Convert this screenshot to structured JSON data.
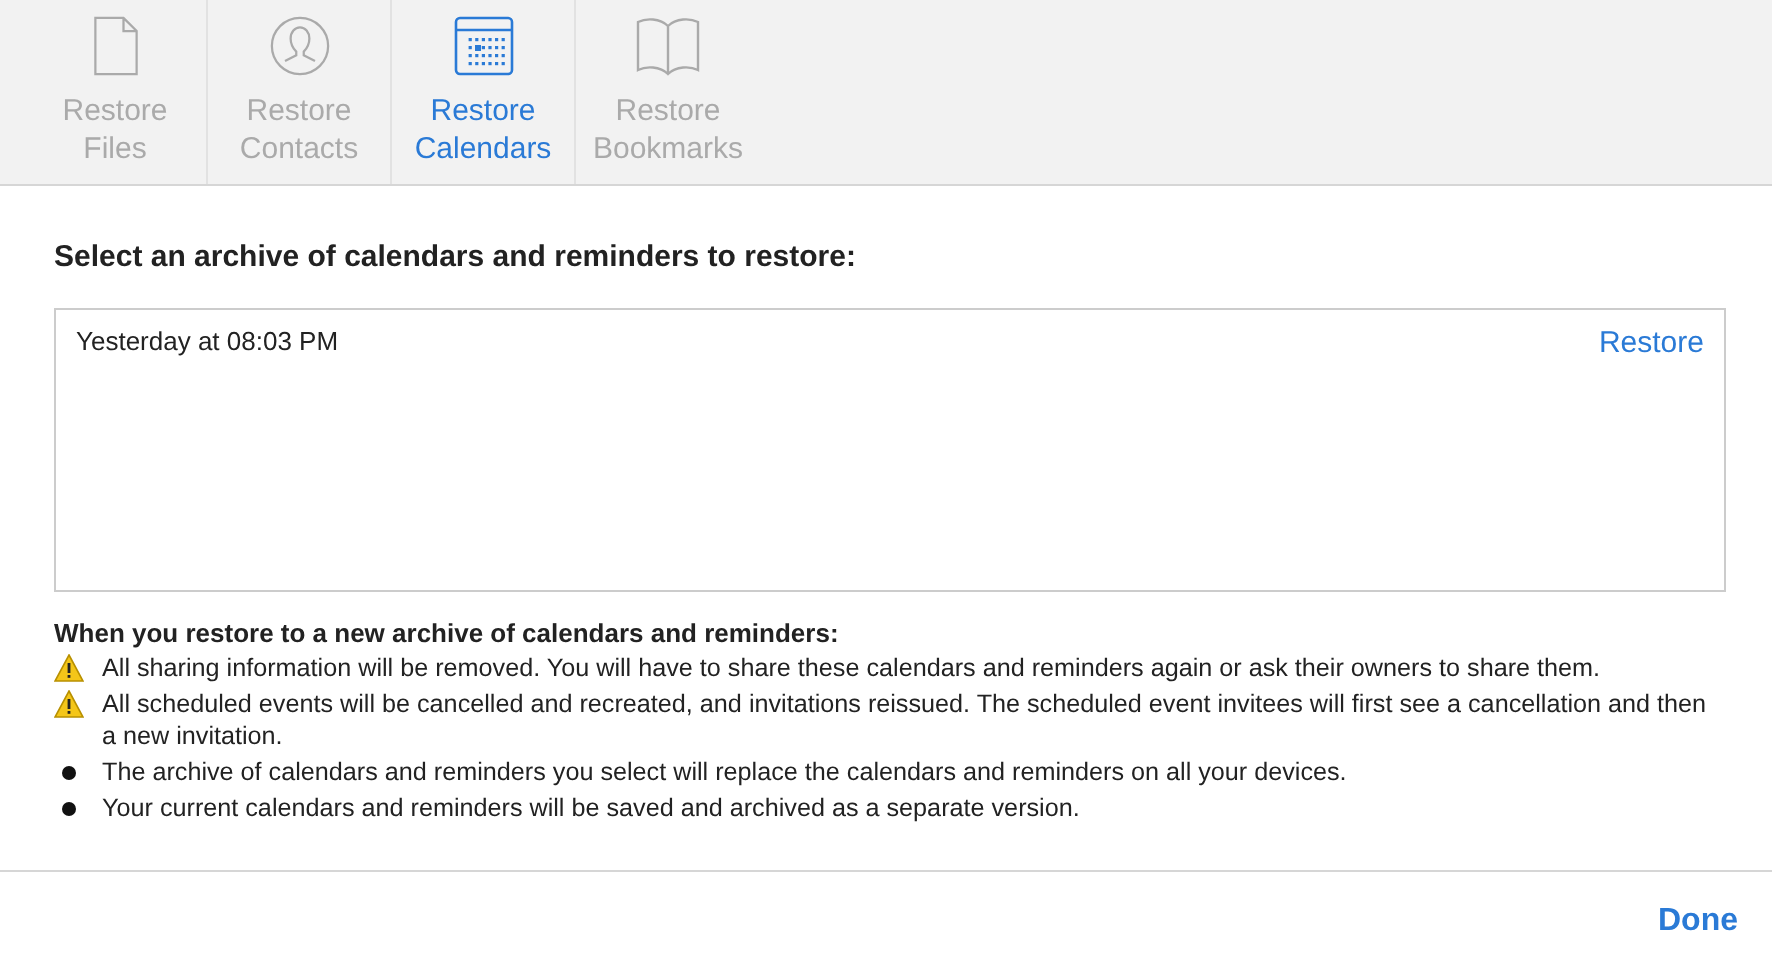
{
  "tabs": [
    {
      "kind": "file",
      "label": "Restore Files",
      "selected": false
    },
    {
      "kind": "contacts",
      "label": "Restore Contacts",
      "selected": false
    },
    {
      "kind": "calendar",
      "label": "Restore Calendars",
      "selected": true
    },
    {
      "kind": "bookmarks",
      "label": "Restore Bookmarks",
      "selected": false
    }
  ],
  "heading": "Select an archive of calendars and reminders to restore:",
  "archives": [
    {
      "date": "Yesterday at 08:03 PM",
      "action": "Restore"
    }
  ],
  "notes": {
    "heading": "When you restore to a new archive of calendars and reminders:",
    "items": [
      {
        "kind": "warning",
        "text": "All sharing information will be removed. You will have to share these calendars and reminders again or ask their owners to share them."
      },
      {
        "kind": "warning",
        "text": "All scheduled events will be cancelled and recreated, and invitations reissued. The scheduled event invitees will first see a cancellation and then a new invitation."
      },
      {
        "kind": "bullet",
        "text": "The archive of calendars and reminders you select will replace the calendars and reminders on all your devices."
      },
      {
        "kind": "bullet",
        "text": "Your current calendars and reminders will be saved and archived as a separate version."
      }
    ]
  },
  "done": "Done"
}
